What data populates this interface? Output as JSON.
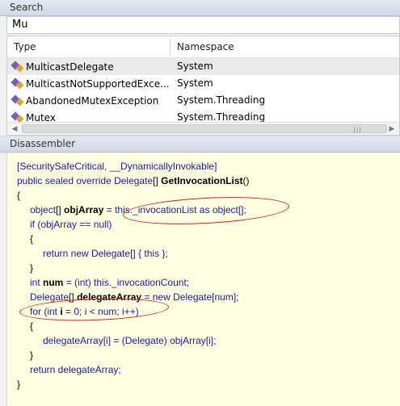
{
  "search": {
    "title": "Search",
    "query": "Mu"
  },
  "results": {
    "columns": [
      "Type",
      "Namespace"
    ],
    "rows": [
      {
        "name": "MulticastDelegate",
        "namespace": "System",
        "icon": "class-icon",
        "selected": true
      },
      {
        "name": "MulticastNotSupportedExce...",
        "namespace": "System",
        "icon": "class-icon",
        "selected": false
      },
      {
        "name": "AbandonedMutexException",
        "namespace": "System.Threading",
        "icon": "class-icon",
        "selected": false
      },
      {
        "name": "Mutex",
        "namespace": "System.Threading",
        "icon": "class-icon",
        "selected": false
      }
    ],
    "scroll_grip": "|||"
  },
  "disassembler": {
    "title": "Disassembler",
    "code": {
      "l1": "[SecuritySafeCritical, __DynamicallyInvokable]",
      "l2_kw": "public sealed override ",
      "l2_ty": "Delegate",
      "l2_br": "[] ",
      "l2_name": "GetInvocationList",
      "l2_end": "()",
      "l3": "{",
      "l4_ty": "object",
      "l4_br": "[] ",
      "l4_var": "objArray",
      "l4_rest": " = this._invocationList as object[];",
      "l5": "if (objArray == null)",
      "l6": "{",
      "l7": "return new Delegate[] { this };",
      "l8": "}",
      "l9_kw": "int ",
      "l9_var": "num",
      "l9_rest": " = (int) this._invocationCount;",
      "l10_ty": "Delegate",
      "l10_br": "[] ",
      "l10_var": "delegateArray",
      "l10_rest": " = new Delegate[num];",
      "l11_a": "for (int ",
      "l11_var": "i",
      "l11_rest": " = 0; i < num; i++)",
      "l12": "{",
      "l13": "delegateArray[i] = (Delegate) objArray[i];",
      "l14": "}",
      "l15": "return delegateArray;",
      "l16": "}"
    }
  },
  "colors": {
    "code_background": "#ffffe1",
    "keyword": "#1a1aa6",
    "annotation": "#d42020"
  }
}
